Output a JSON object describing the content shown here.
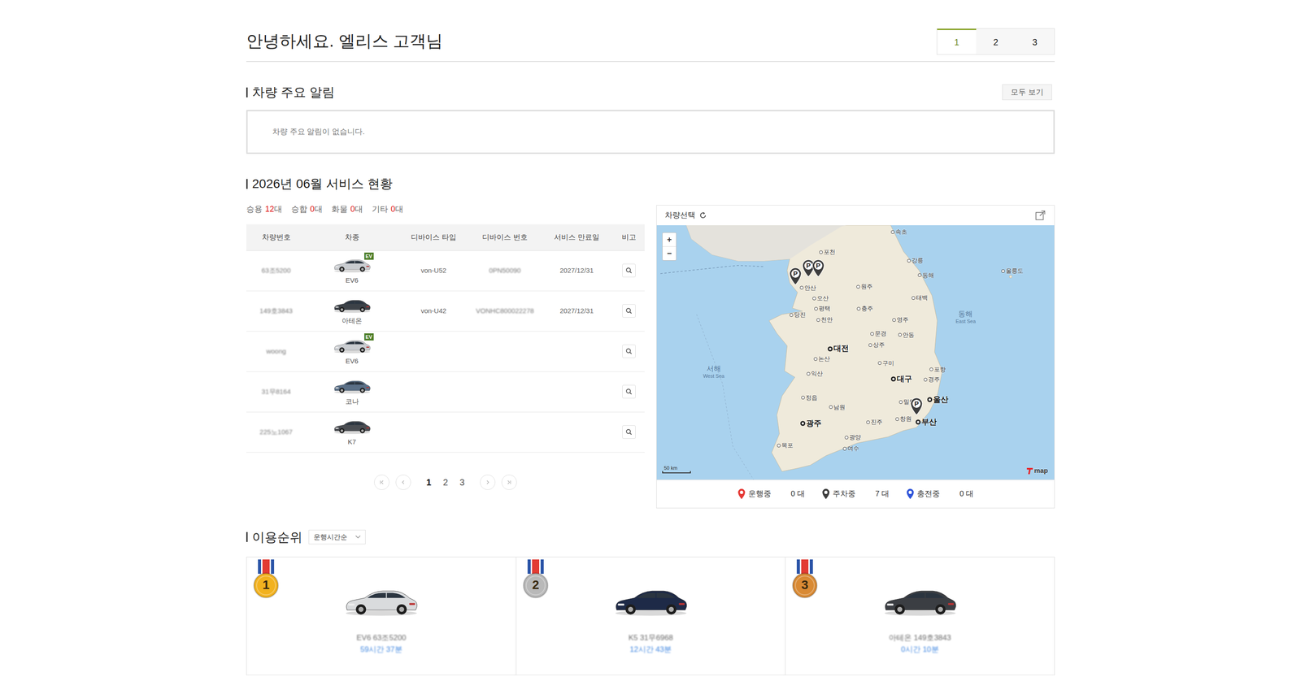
{
  "header": {
    "greeting": "안녕하세요. 엘리스 고객님",
    "tabs": [
      {
        "label": "1",
        "selected": true
      },
      {
        "label": "2",
        "selected": false
      },
      {
        "label": "3",
        "selected": false
      }
    ]
  },
  "alerts": {
    "title": "차량 주요 알림",
    "view_all": "모두 보기",
    "empty_message": "차량 주요 알림이 없습니다."
  },
  "service": {
    "title": "2026년 06월 서비스 현황",
    "counts": [
      {
        "label": "승용",
        "count": "12",
        "unit": "대"
      },
      {
        "label": "승합",
        "count": "0",
        "unit": "대"
      },
      {
        "label": "화물",
        "count": "0",
        "unit": "대"
      },
      {
        "label": "기타",
        "count": "0",
        "unit": "대"
      }
    ],
    "table": {
      "columns": [
        {
          "label": "차량번호",
          "blurred": true
        },
        {
          "label": "차종",
          "blurred": false
        },
        {
          "label": "디바이스 타입",
          "blurred": false
        },
        {
          "label": "디바이스 번호",
          "blurred": true
        },
        {
          "label": "서비스 만료일",
          "blurred": false
        },
        {
          "label": "비고",
          "blurred": false
        }
      ],
      "rows": [
        {
          "plate": "63조5200",
          "model": "EV6",
          "badge": "EV",
          "car_color": "#c9ccd0",
          "device_type": "von-U52",
          "device_number": "0PN50090",
          "expiry": "2027/12/31"
        },
        {
          "plate": "149호3843",
          "model": "아테온",
          "car_color": "#3d4248",
          "device_type": "von-U42",
          "device_number": "VONHC800022278",
          "expiry": "2027/12/31"
        },
        {
          "plate": "woong",
          "model": "EV6",
          "badge": "EV",
          "car_color": "#c9ccd0",
          "device_type": "",
          "device_number": "",
          "expiry": ""
        },
        {
          "plate": "31무8164",
          "model": "코나",
          "car_color": "#5a6f86",
          "device_type": "",
          "device_number": "",
          "expiry": ""
        },
        {
          "plate": "225노1067",
          "model": "K7",
          "car_color": "#4a4d52",
          "device_type": "",
          "device_number": "",
          "expiry": ""
        }
      ]
    },
    "pagination": {
      "pages": [
        {
          "label": "1",
          "selected": true
        },
        {
          "label": "2",
          "selected": false
        },
        {
          "label": "3",
          "selected": false
        }
      ]
    }
  },
  "map": {
    "title": "차량선택",
    "zoom": [
      "+",
      "−"
    ],
    "scale": "50 km",
    "logo": "map",
    "sea_labels": [
      {
        "text": "서해",
        "sub": "West Sea",
        "lat": 35.98,
        "lon": 125.13
      },
      {
        "text": "동해",
        "sub": "East Sea",
        "lat": 36.85,
        "lon": 130.0
      }
    ],
    "cities": [
      {
        "name": "속초",
        "lat": 38.21,
        "lon": 128.59,
        "major": false
      },
      {
        "name": "강릉",
        "lat": 37.75,
        "lon": 128.9,
        "major": false
      },
      {
        "name": "동해",
        "lat": 37.52,
        "lon": 129.11,
        "major": false
      },
      {
        "name": "포천",
        "lat": 37.89,
        "lon": 127.2,
        "major": false
      },
      {
        "name": "안산",
        "lat": 37.32,
        "lon": 126.83,
        "major": false
      },
      {
        "name": "원주",
        "lat": 37.34,
        "lon": 127.92,
        "major": false
      },
      {
        "name": "오산",
        "lat": 37.15,
        "lon": 127.07,
        "major": false
      },
      {
        "name": "평택",
        "lat": 36.99,
        "lon": 127.11,
        "major": false
      },
      {
        "name": "충주",
        "lat": 36.99,
        "lon": 127.93,
        "major": false
      },
      {
        "name": "태백",
        "lat": 37.16,
        "lon": 128.99,
        "major": false
      },
      {
        "name": "당진",
        "lat": 36.89,
        "lon": 126.63,
        "major": false
      },
      {
        "name": "천안",
        "lat": 36.81,
        "lon": 127.15,
        "major": false
      },
      {
        "name": "영주",
        "lat": 36.81,
        "lon": 128.62,
        "major": false
      },
      {
        "name": "안동",
        "lat": 36.57,
        "lon": 128.73,
        "major": false
      },
      {
        "name": "문경",
        "lat": 36.59,
        "lon": 128.19,
        "major": false
      },
      {
        "name": "상주",
        "lat": 36.41,
        "lon": 128.16,
        "major": false
      },
      {
        "name": "대전",
        "lat": 36.35,
        "lon": 127.38,
        "major": true
      },
      {
        "name": "논산",
        "lat": 36.19,
        "lon": 127.1,
        "major": false
      },
      {
        "name": "구미",
        "lat": 36.12,
        "lon": 128.34,
        "major": false
      },
      {
        "name": "포항",
        "lat": 36.02,
        "lon": 129.34,
        "major": false
      },
      {
        "name": "익산",
        "lat": 35.95,
        "lon": 126.96,
        "major": false
      },
      {
        "name": "대구",
        "lat": 35.87,
        "lon": 128.6,
        "major": true
      },
      {
        "name": "경주",
        "lat": 35.86,
        "lon": 129.22,
        "major": false
      },
      {
        "name": "정읍",
        "lat": 35.57,
        "lon": 126.86,
        "major": false
      },
      {
        "name": "울산",
        "lat": 35.54,
        "lon": 129.31,
        "major": true
      },
      {
        "name": "밀양",
        "lat": 35.5,
        "lon": 128.75,
        "major": false
      },
      {
        "name": "남원",
        "lat": 35.42,
        "lon": 127.39,
        "major": false
      },
      {
        "name": "광주",
        "lat": 35.16,
        "lon": 126.85,
        "major": true
      },
      {
        "name": "진주",
        "lat": 35.18,
        "lon": 128.11,
        "major": false
      },
      {
        "name": "창원",
        "lat": 35.23,
        "lon": 128.68,
        "major": false
      },
      {
        "name": "부산",
        "lat": 35.18,
        "lon": 129.08,
        "major": true
      },
      {
        "name": "광양",
        "lat": 34.94,
        "lon": 127.7,
        "major": false
      },
      {
        "name": "여수",
        "lat": 34.76,
        "lon": 127.66,
        "major": false
      },
      {
        "name": "목포",
        "lat": 34.81,
        "lon": 126.39,
        "major": false
      },
      {
        "name": "울릉도",
        "lat": 37.59,
        "lon": 130.72,
        "major": false
      }
    ],
    "pins": [
      {
        "status": "parked",
        "label": "P",
        "lat": 37.36,
        "lon": 126.71
      },
      {
        "status": "parked",
        "label": "P",
        "lat": 37.49,
        "lon": 126.96
      },
      {
        "status": "parked",
        "label": "P",
        "lat": 37.49,
        "lon": 127.15
      },
      {
        "status": "parked",
        "label": "P",
        "lat": 35.29,
        "lon": 129.05
      }
    ],
    "legend": [
      {
        "status": "driving",
        "label": "운행중",
        "count": "0 대",
        "color": "#e53935"
      },
      {
        "status": "parked",
        "label": "주차중",
        "count": "7 대",
        "color": "#3d3d3d"
      },
      {
        "status": "charging",
        "label": "충전중",
        "count": "0 대",
        "color": "#2f54d9"
      }
    ]
  },
  "ranking": {
    "title": "이용순위",
    "sort": "운행시간순",
    "items": [
      {
        "rank": "1",
        "medal_color": "#f2b21f",
        "car_color": "#d9dbdd",
        "name": "EV6 63조5200",
        "time": "59시간 37분",
        "blurred": true
      },
      {
        "rank": "2",
        "medal_color": "#b9b9b9",
        "car_color": "#1e2a47",
        "name": "K5 31무6968",
        "time": "12시간 43분",
        "blurred": true
      },
      {
        "rank": "3",
        "medal_color": "#d98a34",
        "car_color": "#3b3e43",
        "name": "아테온 149호3843",
        "time": "0시간 10분",
        "blurred": true
      }
    ]
  }
}
